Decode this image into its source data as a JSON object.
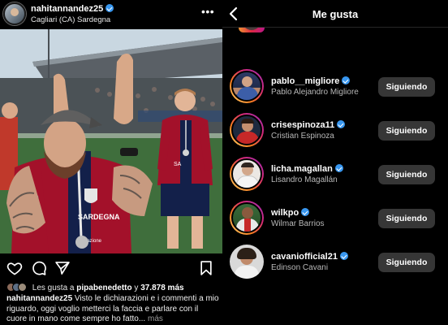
{
  "post": {
    "username": "nahitannandez25",
    "location": "Cagliari (CA) Sardegna",
    "more_glyph": "•••",
    "jersey": {
      "left_sponsor": "SARDEGNA",
      "left_small": "dazione",
      "right_sponsor": "SA"
    },
    "likes": {
      "prefix": "Les gusta a",
      "user": "pipabenedetto",
      "joiner": "y",
      "count": "37.878 más"
    },
    "caption": {
      "username": "nahitannandez25",
      "text": "Visto le dichiarazioni e i commenti a mio riguardo, oggi voglio metterci la faccia e parlare con il cuore in mano come sempre ho fatto...",
      "more": "más"
    },
    "actions": {
      "like_icon": "heart-icon",
      "comment_icon": "comment-icon",
      "share_icon": "send-icon",
      "save_icon": "bookmark-icon"
    }
  },
  "likes_panel": {
    "title": "Me gusta",
    "users": [
      {
        "handle": "pablo__migliore",
        "name": "Pablo Alejandro Migliore",
        "button": "Siguiendo",
        "verified": true,
        "ring": true
      },
      {
        "handle": "crisespinoza11",
        "name": "Cristian Espinoza",
        "button": "Siguiendo",
        "verified": true,
        "ring": true
      },
      {
        "handle": "licha.magallan",
        "name": "Lisandro Magallán",
        "button": "Siguiendo",
        "verified": true,
        "ring": true
      },
      {
        "handle": "wilkpo",
        "name": "Wilmar Barrios",
        "button": "Siguiendo",
        "verified": true,
        "ring": true
      },
      {
        "handle": "cavaniofficial21",
        "name": "Edinson Cavani",
        "button": "Siguiendo",
        "verified": true,
        "ring": false
      }
    ]
  },
  "colors": {
    "background": "#000000",
    "verified_blue": "#3897f0",
    "button_bg": "#363636",
    "cagliari_red": "#a3112a",
    "cagliari_blue": "#13204a"
  }
}
